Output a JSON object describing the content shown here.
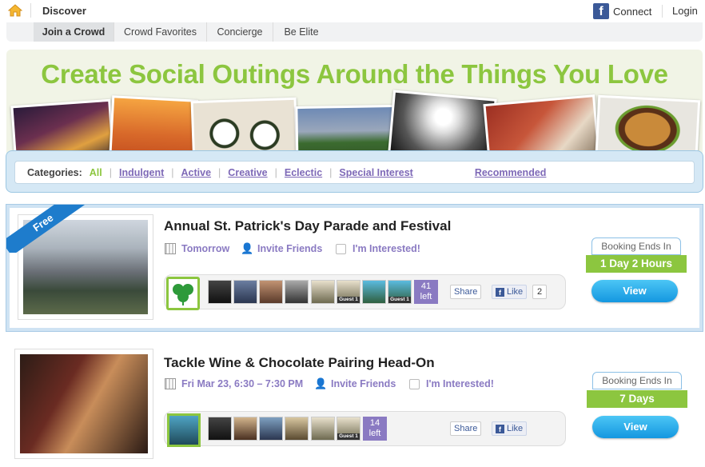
{
  "header": {
    "section": "Discover",
    "connect_label": "Connect",
    "login_label": "Login",
    "fb_glyph": "f"
  },
  "nav": {
    "tabs": [
      {
        "label": "Join a Crowd",
        "active": true
      },
      {
        "label": "Crowd Favorites"
      },
      {
        "label": "Concierge"
      },
      {
        "label": "Be Elite"
      }
    ]
  },
  "hero": {
    "title": "Create Social Outings Around the Things You Love"
  },
  "categories": {
    "label": "Categories:",
    "items": [
      "All",
      "Indulgent",
      "Active",
      "Creative",
      "Eclectic",
      "Special Interest"
    ],
    "recommended": "Recommended"
  },
  "events": [
    {
      "badge": "Free",
      "title": "Annual St. Patrick's Day Parade and Festival",
      "date": "Tomorrow",
      "invite": "Invite Friends",
      "interested": "I'm Interested!",
      "spots_count": "41",
      "spots_unit": "left",
      "guest_label": "Guest 1",
      "share_label": "Share",
      "like_label": "Like",
      "like_count": "2",
      "booking_label": "Booking Ends In",
      "booking_value": "1 Day 2 Hours",
      "view_label": "View"
    },
    {
      "title": "Tackle Wine & Chocolate Pairing Head-On",
      "date": "Fri Mar 23, 6:30 – 7:30 PM",
      "invite": "Invite Friends",
      "interested": "I'm Interested!",
      "spots_count": "14",
      "spots_unit": "left",
      "guest_label": "Guest 1",
      "share_label": "Share",
      "like_label": "Like",
      "booking_label": "Booking Ends In",
      "booking_value": "7 Days",
      "view_label": "View"
    }
  ],
  "colors": {
    "accent_green": "#8cc63f",
    "link_purple": "#7e69b7",
    "button_blue": "#1497e0",
    "facebook": "#3b5998"
  }
}
